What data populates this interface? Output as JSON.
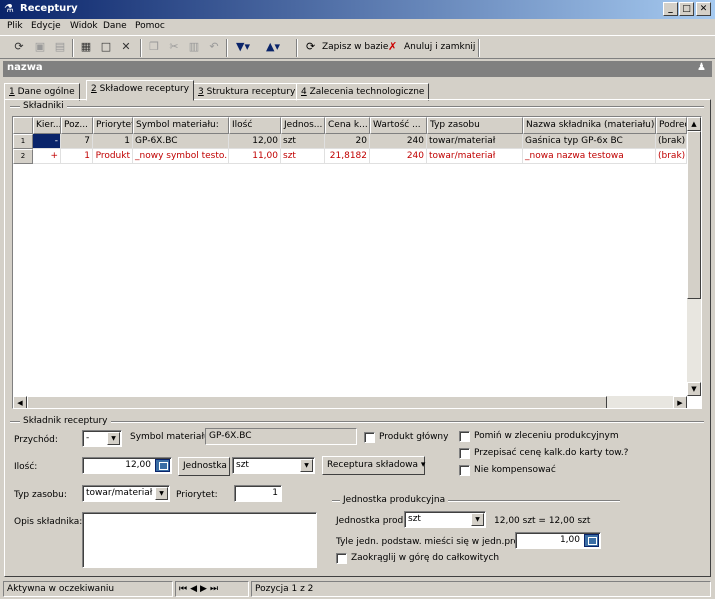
{
  "window": {
    "title": "Receptury"
  },
  "menu": [
    "Plik",
    "Edycje",
    "Widok",
    "Dane",
    "Pomoc"
  ],
  "toolbar": {
    "save_label": "Zapisz w bazie",
    "cancel_label": "Anuluj i zamknij"
  },
  "header": {
    "label": "nazwa"
  },
  "tabs": [
    {
      "num": "1",
      "label": "Dane ogólne"
    },
    {
      "num": "2",
      "label": "Składowe receptury"
    },
    {
      "num": "3",
      "label": "Struktura receptury"
    },
    {
      "num": "4",
      "label": "Zalecenia technologiczne"
    }
  ],
  "grid": {
    "group_label": "Składniki",
    "columns": [
      "Kier...",
      "Poz...",
      "Priorytet",
      "Symbol materiału:",
      "Ilość",
      "Jednos...",
      "Cena k...",
      "Wartość ...",
      "Typ zasobu",
      "Nazwa składnika (materiału)",
      "Podreci"
    ],
    "rows": [
      {
        "num": "1",
        "cells": [
          "-",
          "7",
          "1",
          "GP-6X.BC",
          "12,00",
          "szt",
          "20",
          "240",
          "towar/materiał",
          "Gaśnica typ GP-6x BC",
          "(brak)"
        ]
      },
      {
        "num": "2",
        "cells": [
          "+",
          "1",
          "Produkt",
          "_nowy symbol testo...",
          "11,00",
          "szt",
          "21,8182",
          "240",
          "towar/materiał",
          "_nowa nazwa testowa",
          "(brak)"
        ]
      }
    ]
  },
  "form": {
    "group_label": "Składnik receptury",
    "przychod_label": "Przychód:",
    "przychod_value": "-",
    "symbol_label": "Symbol materiału:",
    "symbol_value": "GP-6X.BC",
    "produkt_glowny_label": "Produkt główny",
    "ilosc_label": "Ilość:",
    "ilosc_value": "12,00",
    "jednostka_btn": "Jednostka",
    "jednostka_value": "szt",
    "receptura_btn": "Receptura składowa",
    "typ_label": "Typ zasobu:",
    "typ_value": "towar/materiał",
    "priorytet_label": "Priorytet:",
    "priorytet_value": "1",
    "opis_label": "Opis składnika:",
    "pomin_label": "Pomiń w zleceniu produkcyjnym",
    "przepisac_label": "Przepisać cenę kalk.do karty tow.?",
    "nie_komp_label": "Nie kompensować",
    "jp_group_label": "Jednostka produkcyjna",
    "jp_label": "Jednostka prod.",
    "jp_value": "szt",
    "jp_conversion": "12,00 szt = 12,00 szt",
    "tyle_label": "Tyle jedn. podstaw. mieści się w jedn.prod.",
    "tyle_value": "1,00",
    "zaokraglij_label": "Zaokrąglij w górę do całkowitych"
  },
  "status": {
    "state": "Aktywna w oczekiwaniu",
    "position": "Pozycja 1 z 2"
  }
}
